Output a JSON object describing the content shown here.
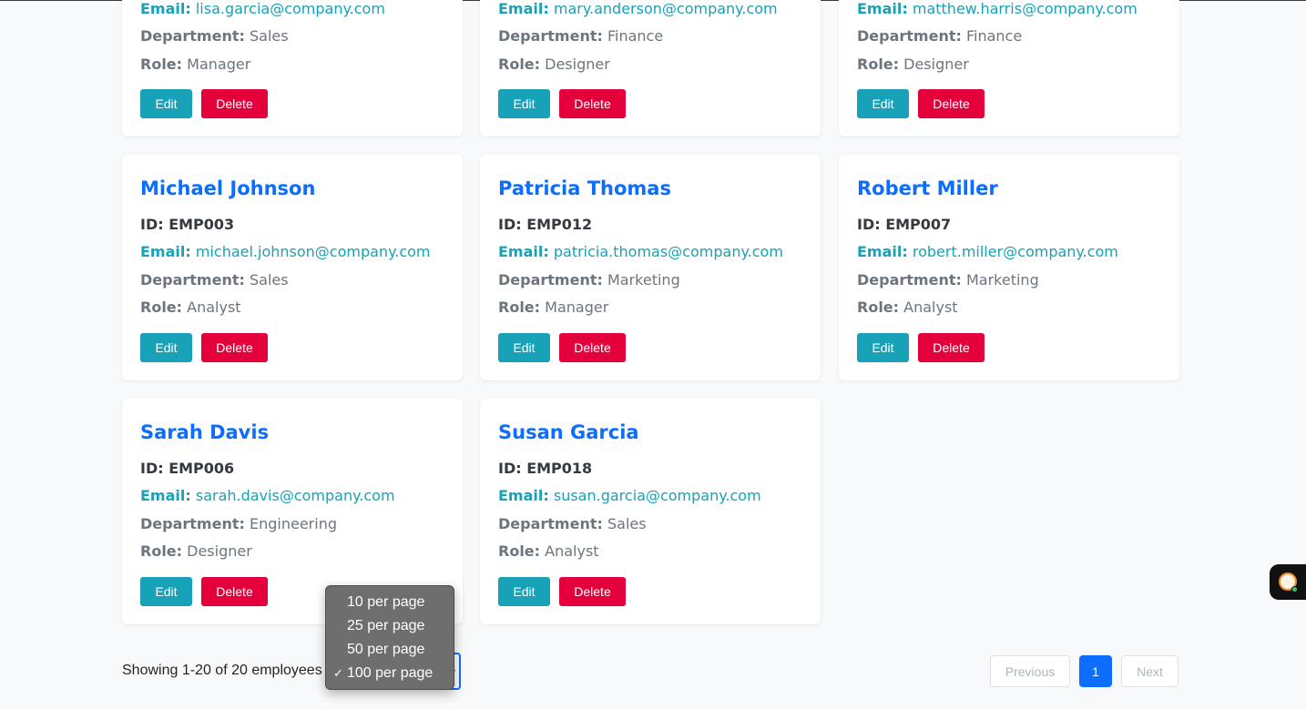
{
  "cards_top": [
    {
      "email": "lisa.garcia@company.com",
      "department": "Sales",
      "role": "Manager"
    },
    {
      "email": "mary.anderson@company.com",
      "department": "Finance",
      "role": "Designer"
    },
    {
      "email": "matthew.harris@company.com",
      "department": "Finance",
      "role": "Designer"
    }
  ],
  "cards": [
    {
      "name": "Michael Johnson",
      "id": "EMP003",
      "email": "michael.johnson@company.com",
      "department": "Sales",
      "role": "Analyst"
    },
    {
      "name": "Patricia Thomas",
      "id": "EMP012",
      "email": "patricia.thomas@company.com",
      "department": "Marketing",
      "role": "Manager"
    },
    {
      "name": "Robert Miller",
      "id": "EMP007",
      "email": "robert.miller@company.com",
      "department": "Marketing",
      "role": "Analyst"
    },
    {
      "name": "Sarah Davis",
      "id": "EMP006",
      "email": "sarah.davis@company.com",
      "department": "Engineering",
      "role": "Designer"
    },
    {
      "name": "Susan Garcia",
      "id": "EMP018",
      "email": "susan.garcia@company.com",
      "department": "Sales",
      "role": "Analyst"
    }
  ],
  "labels": {
    "id_prefix": "ID: ",
    "email": "Email:",
    "department": "Department:",
    "role": "Role:",
    "edit": "Edit",
    "delete": "Delete"
  },
  "footer": {
    "showing_text": "Showing 1-20 of 20 employees"
  },
  "per_page": {
    "options": [
      "10 per page",
      "25 per page",
      "50 per page",
      "100 per page"
    ],
    "selected": "100 per page",
    "checkmark": "✓"
  },
  "pagination": {
    "previous": "Previous",
    "current_page": "1",
    "next": "Next"
  },
  "colors": {
    "name": "#0d6efd",
    "email": "#17a2b8",
    "edit_button": "#17a2b8",
    "delete_button": "#e4003a",
    "active_page": "#0d6efd"
  },
  "icons": {
    "widget": "chat-assistant-icon"
  }
}
